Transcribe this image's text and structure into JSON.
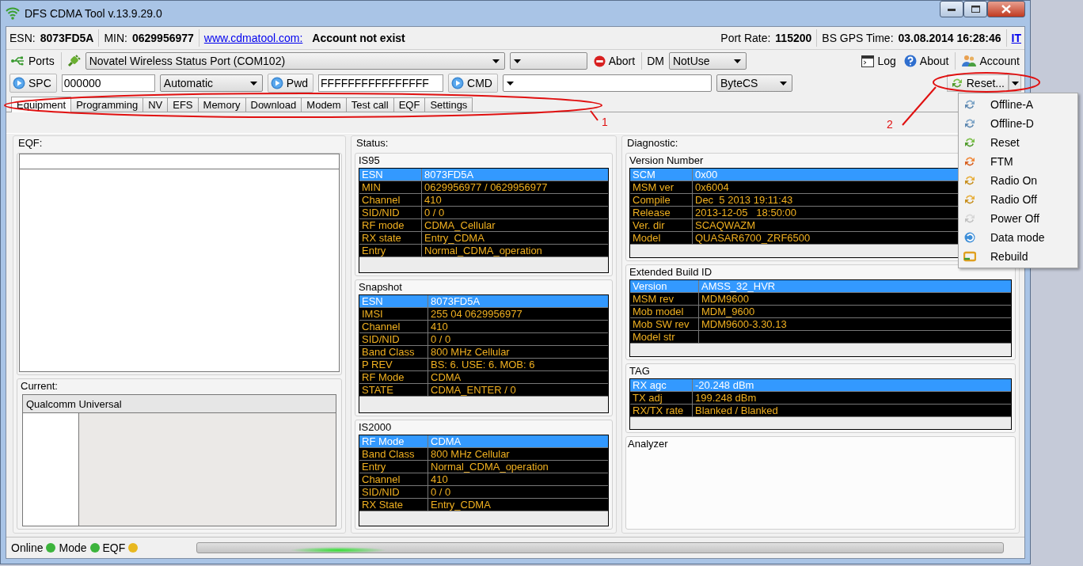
{
  "window": {
    "title": "DFS CDMA Tool v.13.9.29.0"
  },
  "info_bar": {
    "esn_label": "ESN:",
    "esn": "8073FD5A",
    "min_label": "MIN:",
    "min": "0629956977",
    "link": "www.cdmatool.com:",
    "account_status": "Account not exist",
    "port_rate_label": "Port Rate:",
    "port_rate": "115200",
    "gps_time_label": "BS GPS Time:",
    "gps_time": "03.08.2014 16:28:46",
    "language": "IT"
  },
  "toolbar": {
    "ports": "Ports",
    "port_select": "Novatel Wireless Status Port (COM102)",
    "abort": "Abort",
    "dm_label": "DM",
    "dm_select": "NotUse",
    "log": "Log",
    "about": "About",
    "account": "Account"
  },
  "command_bar": {
    "spc_button": "SPC",
    "spc": "000000",
    "mode_select": "Automatic",
    "pwd_button": "Pwd",
    "pwd": "FFFFFFFFFFFFFFFF",
    "cmd_button": "CMD",
    "checksum_select": "ByteCS",
    "reset_button": "Reset..."
  },
  "tabs": [
    {
      "label": "Equipment",
      "selected": true
    },
    {
      "label": "Programming",
      "selected": false
    },
    {
      "label": "NV",
      "selected": false
    },
    {
      "label": "EFS",
      "selected": false
    },
    {
      "label": "Memory",
      "selected": false
    },
    {
      "label": "Download",
      "selected": false
    },
    {
      "label": "Modem",
      "selected": false
    },
    {
      "label": "Test call",
      "selected": false
    },
    {
      "label": "EQF",
      "selected": false
    },
    {
      "label": "Settings",
      "selected": false
    }
  ],
  "eqf": {
    "title": "EQF:"
  },
  "current": {
    "title": "Current:",
    "header": "Qualcomm Universal"
  },
  "status": {
    "title": "Status:",
    "groups": [
      {
        "title": "IS95",
        "rows": [
          {
            "name": "ESN",
            "value": "8073FD5A",
            "selected": true
          },
          {
            "name": "MIN",
            "value": "0629956977 / 0629956977",
            "selected": false
          },
          {
            "name": "Channel",
            "value": "410",
            "selected": false
          },
          {
            "name": "SID/NID",
            "value": "0 / 0",
            "selected": false
          },
          {
            "name": "RF mode",
            "value": "CDMA_Cellular",
            "selected": false
          },
          {
            "name": "RX state",
            "value": "Entry_CDMA",
            "selected": false
          },
          {
            "name": "Entry",
            "value": "Normal_CDMA_operation",
            "selected": false
          }
        ]
      },
      {
        "title": "Snapshot",
        "rows": [
          {
            "name": "ESN",
            "value": "8073FD5A",
            "selected": true
          },
          {
            "name": "IMSI",
            "value": "255 04 0629956977",
            "selected": false
          },
          {
            "name": "Channel",
            "value": "410",
            "selected": false
          },
          {
            "name": "SID/NID",
            "value": "0 / 0",
            "selected": false
          },
          {
            "name": "Band Class",
            "value": "800 MHz Cellular",
            "selected": false
          },
          {
            "name": "P REV",
            "value": "BS: 6. USE: 6. MOB: 6",
            "selected": false
          },
          {
            "name": "RF Mode",
            "value": "CDMA",
            "selected": false
          },
          {
            "name": "STATE",
            "value": "CDMA_ENTER / 0",
            "selected": false
          }
        ]
      },
      {
        "title": "IS2000",
        "rows": [
          {
            "name": "RF Mode",
            "value": "CDMA",
            "selected": true
          },
          {
            "name": "Band Class",
            "value": "800 MHz Cellular",
            "selected": false
          },
          {
            "name": "Entry",
            "value": "Normal_CDMA_operation",
            "selected": false
          },
          {
            "name": "Channel",
            "value": "410",
            "selected": false
          },
          {
            "name": "SID/NID",
            "value": "0 / 0",
            "selected": false
          },
          {
            "name": "RX State",
            "value": "Entry_CDMA",
            "selected": false
          }
        ]
      }
    ]
  },
  "diagnostic": {
    "title": "Diagnostic:",
    "groups": [
      {
        "title": "Version Number",
        "rows": [
          {
            "name": "SCM",
            "value": "0x00",
            "selected": true
          },
          {
            "name": "MSM ver",
            "value": "0x6004",
            "selected": false
          },
          {
            "name": "Compile",
            "value": "Dec  5 2013 19:11:43",
            "selected": false
          },
          {
            "name": "Release",
            "value": "2013-12-05   18:50:00",
            "selected": false
          },
          {
            "name": "Ver. dir",
            "value": "SCAQWAZM",
            "selected": false
          },
          {
            "name": "Model",
            "value": "QUASAR6700_ZRF6500",
            "selected": false
          }
        ]
      },
      {
        "title": "Extended Build ID",
        "rows": [
          {
            "name": "Version",
            "value": "AMSS_32_HVR",
            "selected": true
          },
          {
            "name": "MSM rev",
            "value": "MDM9600",
            "selected": false
          },
          {
            "name": "Mob model",
            "value": "MDM_9600",
            "selected": false
          },
          {
            "name": "Mob SW rev",
            "value": "MDM9600-3.30.13",
            "selected": false
          },
          {
            "name": "Model str",
            "selected": false
          }
        ]
      },
      {
        "title": "TAG",
        "rows": [
          {
            "name": "RX agc",
            "value": "-20.248 dBm",
            "selected": true
          },
          {
            "name": "TX adj",
            "value": "199.248 dBm",
            "selected": false
          },
          {
            "name": "RX/TX rate",
            "value": "Blanked / Blanked",
            "selected": false
          }
        ]
      }
    ],
    "analyzer": {
      "title": "Analyzer"
    }
  },
  "status_bar": {
    "indicators": [
      {
        "label": "Online",
        "color": "#3cb43c"
      },
      {
        "label": "Mode",
        "color": "#3cb43c"
      },
      {
        "label": "EQF",
        "color": "#e8b820"
      }
    ]
  },
  "reset_menu": {
    "items": [
      {
        "label": "Offline-A",
        "kind": "cool"
      },
      {
        "label": "Offline-D",
        "kind": "cool"
      },
      {
        "label": "Reset",
        "kind": "fresh"
      },
      {
        "label": "FTM",
        "kind": "hot"
      },
      {
        "label": "Radio On",
        "kind": "warm"
      },
      {
        "label": "Radio Off",
        "kind": "warm"
      },
      {
        "label": "Power Off",
        "kind": "faded"
      },
      {
        "label": "Data mode",
        "kind": "circle"
      },
      {
        "label": "Rebuild",
        "kind": "loop"
      }
    ]
  },
  "annotations": [
    {
      "number": "1"
    },
    {
      "number": "2"
    }
  ]
}
